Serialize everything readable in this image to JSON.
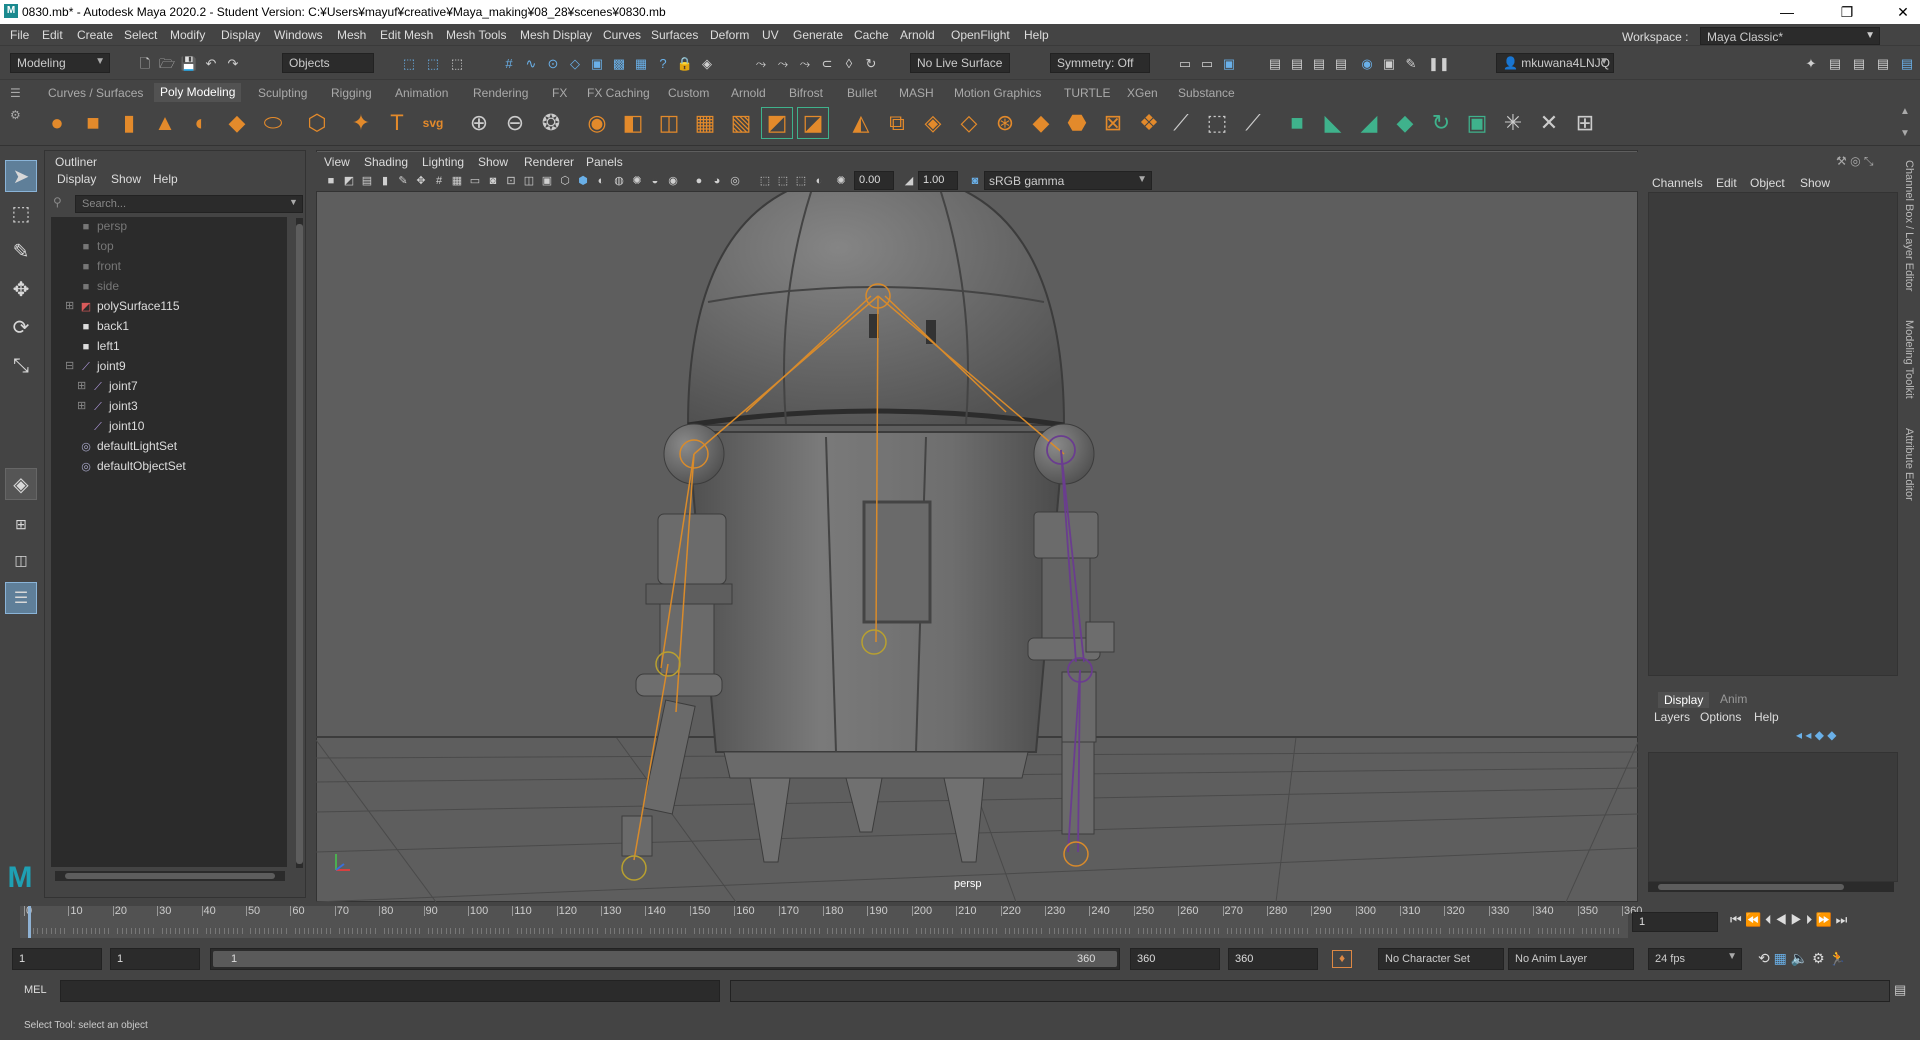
{
  "window": {
    "title": "0830.mb* - Autodesk Maya 2020.2 - Student Version: C:¥Users¥mayuf¥creative¥Maya_making¥08_28¥scenes¥0830.mb",
    "app_icon": "M",
    "minimize": "—",
    "restore": "❐",
    "close": "✕"
  },
  "menubar": [
    "File",
    "Edit",
    "Create",
    "Select",
    "Modify",
    "Display",
    "Windows",
    "Mesh",
    "Edit Mesh",
    "Mesh Tools",
    "Mesh Display",
    "Curves",
    "Surfaces",
    "Deform",
    "UV",
    "Generate",
    "Cache",
    "Arnold",
    "OpenFlight",
    "Help"
  ],
  "workspace": {
    "label": "Workspace :",
    "value": "Maya Classic*"
  },
  "statusline": {
    "menuset": "Modeling",
    "selection_mode": "Objects",
    "live_surface": "No Live Surface",
    "symmetry": "Symmetry: Off",
    "user": "mkuwana4LNJQ"
  },
  "shelf_tabs": [
    "Curves / Surfaces",
    "Poly Modeling",
    "Sculpting",
    "Rigging",
    "Animation",
    "Rendering",
    "FX",
    "FX Caching",
    "Custom",
    "Arnold",
    "Bifrost",
    "Bullet",
    "MASH",
    "Motion Graphics",
    "TURTLE",
    "XGen",
    "Substance"
  ],
  "shelf_active": "Poly Modeling",
  "outliner": {
    "title": "Outliner",
    "menu": [
      "Display",
      "Show",
      "Help"
    ],
    "search_placeholder": "Search...",
    "items": [
      {
        "label": "persp",
        "type": "camera",
        "dim": true
      },
      {
        "label": "top",
        "type": "camera",
        "dim": true
      },
      {
        "label": "front",
        "type": "camera",
        "dim": true
      },
      {
        "label": "side",
        "type": "camera",
        "dim": true
      },
      {
        "label": "polySurface115",
        "type": "mesh",
        "dim": false,
        "expander": "⊞"
      },
      {
        "label": "back1",
        "type": "camera",
        "dim": false
      },
      {
        "label": "left1",
        "type": "camera",
        "dim": false
      },
      {
        "label": "joint9",
        "type": "joint",
        "dim": false,
        "expander": "⊟"
      },
      {
        "label": "joint7",
        "type": "joint",
        "dim": false,
        "expander": "⊞"
      },
      {
        "label": "joint3",
        "type": "joint",
        "dim": false,
        "expander": "⊞"
      },
      {
        "label": "joint10",
        "type": "joint",
        "dim": false
      },
      {
        "label": "defaultLightSet",
        "type": "set",
        "dim": false
      },
      {
        "label": "defaultObjectSet",
        "type": "set",
        "dim": false
      }
    ]
  },
  "viewport": {
    "menu": [
      "View",
      "Shading",
      "Lighting",
      "Show",
      "Renderer",
      "Panels"
    ],
    "value1": "0.00",
    "value2": "1.00",
    "color_space": "sRGB gamma",
    "camera_label": "persp"
  },
  "channel_box": {
    "menu": [
      "Channels",
      "Edit",
      "Object",
      "Show"
    ]
  },
  "layer_editor": {
    "tabs": [
      "Display",
      "Anim"
    ],
    "menu": [
      "Layers",
      "Options",
      "Help"
    ]
  },
  "side_tabs": [
    "Channel Box / Layer Editor",
    "Modeling Toolkit",
    "Attribute Editor"
  ],
  "timeline": {
    "ticks": [
      0,
      10,
      20,
      30,
      40,
      50,
      60,
      70,
      80,
      90,
      100,
      110,
      120,
      130,
      140,
      150,
      160,
      170,
      180,
      190,
      200,
      210,
      220,
      230,
      240,
      250,
      260,
      270,
      280,
      290,
      300,
      310,
      320,
      330,
      340,
      350,
      360
    ],
    "current_frame": "1"
  },
  "range": {
    "start": "1",
    "anim_start": "1",
    "slider_start": "1",
    "slider_end": "360",
    "anim_end": "360",
    "end": "360",
    "character_set": "No Character Set",
    "anim_layer": "No Anim Layer",
    "fps": "24 fps"
  },
  "command_line": {
    "label": "MEL"
  },
  "help_line": "Select Tool: select an object",
  "colors": {
    "bg": "#444444",
    "panel_dark": "#2b2b2b",
    "viewport": "#5e5e5e",
    "accent": "#5f7f99",
    "joint": "#d98b2b",
    "joint_selected": "#6a3d8f",
    "shelf_orange": "#e38a2b",
    "shelf_teal": "#3fb28c"
  }
}
